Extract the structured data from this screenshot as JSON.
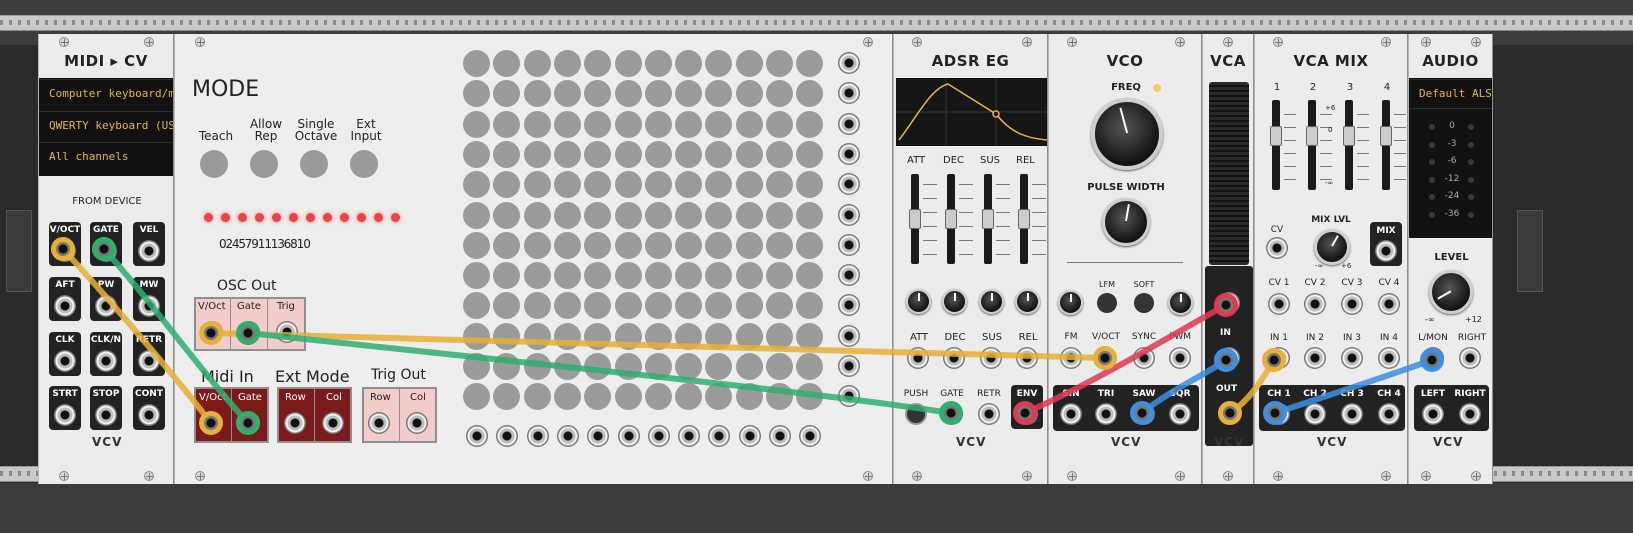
{
  "modules": {
    "midi_cv": {
      "title": "MIDI ▸ CV",
      "rows": [
        "Computer keyboard/m",
        "QWERTY keyboard (US",
        "All channels"
      ],
      "section": "FROM DEVICE",
      "jacks": [
        "V/OCT",
        "GATE",
        "VEL",
        "AFT",
        "PW",
        "MW",
        "CLK",
        "CLK/N",
        "RETR",
        "STRT",
        "STOP",
        "CONT"
      ],
      "brand": "VCV"
    },
    "seq": {
      "mode_title": "MODE",
      "mode_buttons": [
        "Teach",
        "Allow\nRep",
        "Single\nOctave",
        "Ext\nInput"
      ],
      "led_digits": "0 2 4 5 7 9 11 1 3 6 8 10",
      "osc_out": {
        "title": "OSC Out",
        "labels": [
          "V/Oct",
          "Gate",
          "Trig"
        ]
      },
      "midi_in": {
        "title": "Midi In",
        "labels": [
          "V/Oct",
          "Gate"
        ]
      },
      "ext_mode": {
        "title": "Ext Mode",
        "labels": [
          "Row",
          "Col"
        ]
      },
      "trig_out": {
        "title": "Trig Out",
        "labels": [
          "Row",
          "Col"
        ]
      }
    },
    "adsr": {
      "title": "ADSR EG",
      "sliders": [
        "ATT",
        "DEC",
        "SUS",
        "REL"
      ],
      "knobs": [
        "ATT",
        "DEC",
        "SUS",
        "REL"
      ],
      "bottom": [
        "PUSH",
        "GATE",
        "RETR",
        "ENV"
      ],
      "brand": "VCV"
    },
    "vco": {
      "title": "VCO",
      "freq": "FREQ",
      "pulse_width": "PULSE WIDTH",
      "switches": [
        "LFM",
        "SOFT"
      ],
      "inputs": [
        "FM",
        "V/OCT",
        "SYNC",
        "PWM"
      ],
      "outputs": [
        "SIN",
        "TRI",
        "SAW",
        "SQR"
      ],
      "brand": "VCV"
    },
    "vca": {
      "title": "VCA",
      "in": "IN",
      "out": "OUT",
      "brand": "VCV"
    },
    "vca_mix": {
      "title": "VCA MIX",
      "channels": [
        "1",
        "2",
        "3",
        "4"
      ],
      "scale": [
        "+6",
        "0",
        "-∞"
      ],
      "cv": "CV",
      "mix_lvl": "MIX LVL",
      "mix": "MIX",
      "knob_min": "-∞",
      "knob_max": "+6",
      "cv_row": [
        "CV 1",
        "CV 2",
        "CV 3",
        "CV 4"
      ],
      "in_row": [
        "IN 1",
        "IN 2",
        "IN 3",
        "IN 4"
      ],
      "ch_row": [
        "CH 1",
        "CH 2",
        "CH 3",
        "CH 4"
      ],
      "brand": "VCV"
    },
    "audio": {
      "title": "AUDIO",
      "device": "Default ALS",
      "meter": [
        "0",
        "-3",
        "-6",
        "-12",
        "-24",
        "-36"
      ],
      "level": "LEVEL",
      "level_min": "-∞",
      "level_max": "+12",
      "inputs": [
        "L/MON",
        "RIGHT"
      ],
      "outputs": [
        "LEFT",
        "RIGHT"
      ],
      "brand": "VCV"
    }
  },
  "colors": {
    "cable_yellow": "#e8b038",
    "cable_green": "#2fae6e",
    "cable_red": "#e0394f",
    "cable_blue": "#3d8fe0",
    "panel": "#ececec",
    "lcd_text": "#e6b64a"
  }
}
